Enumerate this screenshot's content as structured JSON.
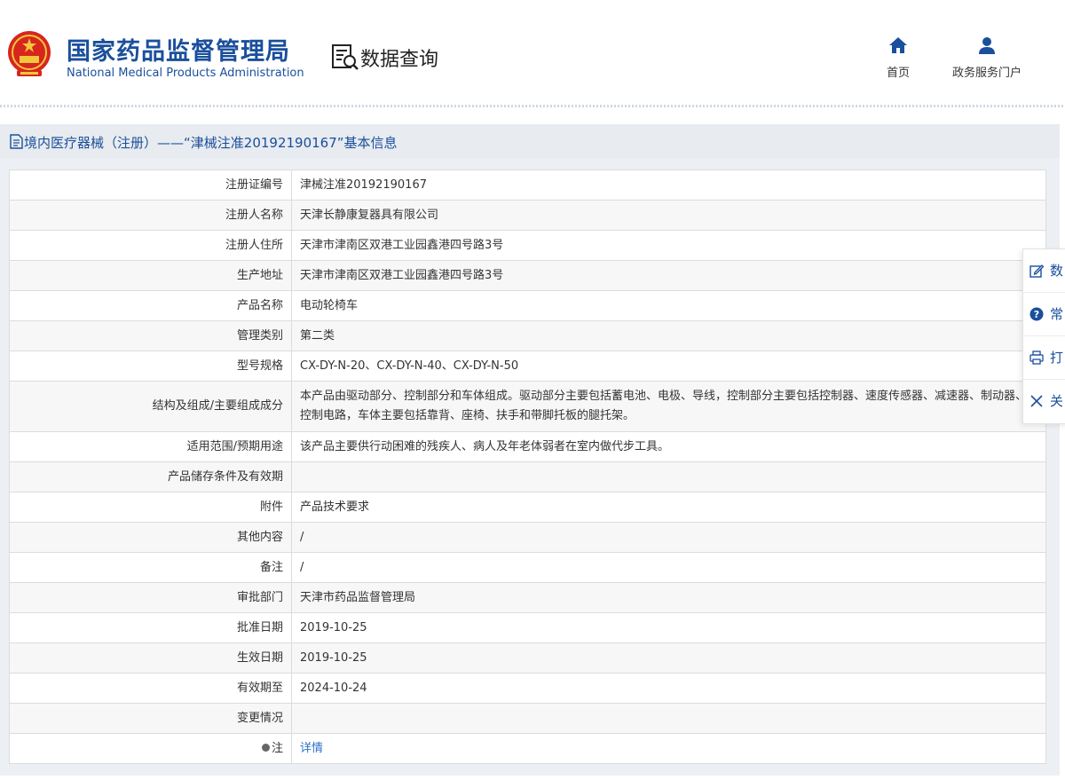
{
  "header": {
    "org_cn": "国家药品监督管理局",
    "org_en": "National Medical Products Administration",
    "section_title": "数据查询",
    "nav": {
      "home": "首页",
      "portal": "政务服务门户"
    }
  },
  "card": {
    "title": "境内医疗器械（注册）——“津械注准20192190167”基本信息"
  },
  "rows": [
    {
      "label": "注册证编号",
      "value": "津械注准20192190167"
    },
    {
      "label": "注册人名称",
      "value": "天津长静康复器具有限公司"
    },
    {
      "label": "注册人住所",
      "value": "天津市津南区双港工业园鑫港四号路3号"
    },
    {
      "label": "生产地址",
      "value": "天津市津南区双港工业园鑫港四号路3号"
    },
    {
      "label": "产品名称",
      "value": "电动轮椅车"
    },
    {
      "label": "管理类别",
      "value": "第二类"
    },
    {
      "label": "型号规格",
      "value": "CX-DY-N-20、CX-DY-N-40、CX-DY-N-50"
    },
    {
      "label": "结构及组成/主要组成成分",
      "value": "本产品由驱动部分、控制部分和车体组成。驱动部分主要包括蓄电池、电极、导线，控制部分主要包括控制器、速度传感器、减速器、制动器、控制电路，车体主要包括靠背、座椅、扶手和带脚托板的腿托架。"
    },
    {
      "label": "适用范围/预期用途",
      "value": "该产品主要供行动困难的残疾人、病人及年老体弱者在室内做代步工具。"
    },
    {
      "label": "产品储存条件及有效期",
      "value": ""
    },
    {
      "label": "附件",
      "value": "产品技术要求"
    },
    {
      "label": "其他内容",
      "value": "/"
    },
    {
      "label": "备注",
      "value": "/"
    },
    {
      "label": "审批部门",
      "value": "天津市药品监督管理局"
    },
    {
      "label": "批准日期",
      "value": "2019-10-25"
    },
    {
      "label": "生效日期",
      "value": "2019-10-25"
    },
    {
      "label": "有效期至",
      "value": "2024-10-24"
    },
    {
      "label": "变更情况",
      "value": ""
    },
    {
      "label": "注",
      "value": "详情"
    }
  ],
  "side_panel": {
    "items": [
      {
        "label": "数",
        "icon": "edit-icon"
      },
      {
        "label": "常",
        "icon": "question-icon"
      },
      {
        "label": "打",
        "icon": "print-icon"
      },
      {
        "label": "关",
        "icon": "close-icon"
      }
    ]
  },
  "colors": {
    "brand": "#1a4f9c",
    "link": "#2a6fc9"
  }
}
